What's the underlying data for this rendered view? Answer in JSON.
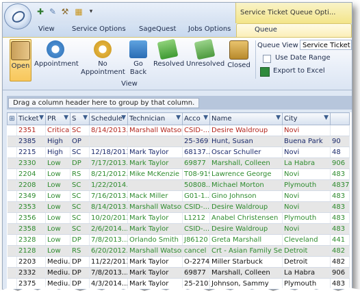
{
  "window": {
    "context_title": "Service Ticket Queue Opti..."
  },
  "tabs": [
    {
      "label": "View"
    },
    {
      "label": "Service Options"
    },
    {
      "label": "SageQuest"
    },
    {
      "label": "Jobs Options"
    },
    {
      "label": "Queue"
    }
  ],
  "ribbon": {
    "buttons": [
      {
        "label": "Open",
        "icon": "door-icon"
      },
      {
        "label": "Appointment",
        "icon": "clock-icon"
      },
      {
        "label": "No Appointment",
        "icon": "clock-warning-icon"
      },
      {
        "label": "Go Back",
        "icon": "back-arrow-icon"
      },
      {
        "label": "Resolved",
        "icon": "check-ticket-icon"
      },
      {
        "label": "Unresolved",
        "icon": "x-ticket-icon"
      },
      {
        "label": "Closed",
        "icon": "closed-door-icon"
      }
    ],
    "group_caption": "View",
    "queue_view_label": "Queue View",
    "queue_view_value": "Service Ticket",
    "use_date_range_label": "Use Date Range",
    "export_label": "Export to Excel"
  },
  "group_panel_text": "Drag a column header here to group by that column.",
  "grid": {
    "columns": [
      "Ticket",
      "PR",
      "S",
      "Schedule",
      "Technician",
      "Acco",
      "Name",
      "City",
      ""
    ],
    "rows": [
      {
        "cells": [
          "2351",
          "Critical",
          "SC",
          "8/14/2013...",
          "Marshall Watson",
          "CSID-...",
          "Desire Waldroup",
          "Novi",
          ""
        ],
        "color": "red",
        "alt": false
      },
      {
        "cells": [
          "2385",
          "High",
          "OP",
          "",
          "",
          "25-3691",
          "Hunt, Susan",
          "Buena Park",
          "90"
        ],
        "color": "navy",
        "alt": true
      },
      {
        "cells": [
          "2215",
          "High",
          "SC",
          "12/18/2013...",
          "Mark Taylor",
          "68137...",
          "Oscar Schuller",
          "Novi",
          "48"
        ],
        "color": "navy",
        "alt": false
      },
      {
        "cells": [
          "2330",
          "Low",
          "DP",
          "7/17/2013...",
          "Mark Taylor",
          "69877",
          "Marshall, Colleen",
          "La Habra",
          "906"
        ],
        "color": "green",
        "alt": true
      },
      {
        "cells": [
          "2204",
          "Low",
          "RS",
          "8/21/2012...",
          "Mike McKenzie",
          "T08-919",
          "Lawrence George",
          "Novi",
          "483"
        ],
        "color": "green",
        "alt": false
      },
      {
        "cells": [
          "2208",
          "Low",
          "SC",
          "1/22/2014...",
          "",
          "50808...",
          "Michael Morton",
          "Plymouth",
          "4837"
        ],
        "color": "green",
        "alt": true
      },
      {
        "cells": [
          "2349",
          "Low",
          "SC",
          "7/16/2013...",
          "Mack Miller",
          "G01-1...",
          "Gino Johnson",
          "Novi",
          "483"
        ],
        "color": "green",
        "alt": false
      },
      {
        "cells": [
          "2353",
          "Low",
          "SC",
          "8/14/2013...",
          "Marshall Watson",
          "CSID-...",
          "Desire Waldroup",
          "Novi",
          "483"
        ],
        "color": "green",
        "alt": true
      },
      {
        "cells": [
          "2356",
          "Low",
          "SC",
          "10/20/2013...",
          "Mark Taylor",
          "L1212",
          "Anabel Christensen",
          "Plymouth",
          "483"
        ],
        "color": "green",
        "alt": false
      },
      {
        "cells": [
          "2358",
          "Low",
          "SC",
          "2/6/2014...",
          "Mark Taylor",
          "CSID-...",
          "Desire Waldroup",
          "Novi",
          "483"
        ],
        "color": "green",
        "alt": true
      },
      {
        "cells": [
          "2328",
          "Low",
          "DP",
          "7/8/2013...",
          "Orlando Smith",
          "J86120",
          "Greta Marshall",
          "Cleveland",
          "441"
        ],
        "color": "green",
        "alt": false
      },
      {
        "cells": [
          "2128",
          "Low",
          "RS",
          "6/20/2012...",
          "Marshall Watson",
          "cancel",
          "Crt - Asian Family Servi...",
          "Detroit",
          "482"
        ],
        "color": "green",
        "alt": true
      },
      {
        "cells": [
          "2203",
          "Mediu...",
          "DP",
          "11/22/2013...",
          "Mark Taylor",
          "O-2274",
          "Miller Starbuck",
          "Detroit",
          "482"
        ],
        "color": "black",
        "alt": false
      },
      {
        "cells": [
          "2332",
          "Mediu...",
          "DP",
          "7/8/2013...",
          "Mark Taylor",
          "69877",
          "Marshall, Colleen",
          "La Habra",
          "906"
        ],
        "color": "black",
        "alt": true
      },
      {
        "cells": [
          "2375",
          "Mediu...",
          "DP",
          "4/3/2014...",
          "Mark Taylor",
          "25-2101",
          "Johnson, Sammy",
          "Plymouth",
          "483"
        ],
        "color": "black",
        "alt": false
      },
      {
        "cells": [
          "2256",
          "Mediu...",
          "IP",
          "12/26/2013...",
          "Larry Jackson",
          "",
          "...Fisher",
          "Canton",
          ""
        ],
        "color": "black",
        "alt": true
      }
    ]
  }
}
